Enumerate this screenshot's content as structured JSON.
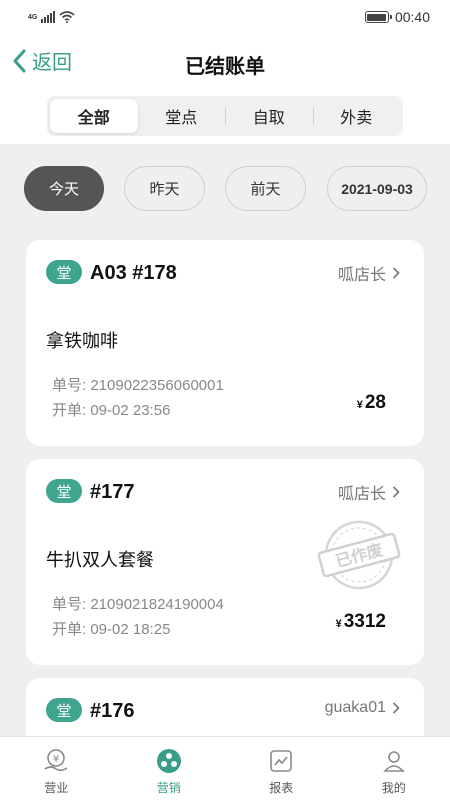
{
  "status_bar": {
    "network": "4G",
    "time": "00:40"
  },
  "header": {
    "back_label": "返回",
    "title": "已结账单"
  },
  "tabs": [
    {
      "label": "全部",
      "active": true
    },
    {
      "label": "堂点",
      "active": false
    },
    {
      "label": "自取",
      "active": false
    },
    {
      "label": "外卖",
      "active": false
    }
  ],
  "date_filters": [
    {
      "label": "今天",
      "active": true
    },
    {
      "label": "昨天",
      "active": false
    },
    {
      "label": "前天",
      "active": false
    },
    {
      "label": "2021-09-03",
      "active": false
    }
  ],
  "orders": [
    {
      "type_badge": "堂",
      "code": "A03 #178",
      "operator": "呱店长",
      "item": "拿铁咖啡",
      "order_no_label": "单号:",
      "order_no": "2109022356060001",
      "open_label": "开单:",
      "open_time": "09-02 23:56",
      "currency": "¥",
      "amount": "28",
      "voided": false
    },
    {
      "type_badge": "堂",
      "code": "#177",
      "operator": "呱店长",
      "item": "牛扒双人套餐",
      "order_no_label": "单号:",
      "order_no": "2109021824190004",
      "open_label": "开单:",
      "open_time": "09-02 18:25",
      "currency": "¥",
      "amount": "3312",
      "voided": true,
      "void_stamp": "已作废"
    },
    {
      "type_badge": "堂",
      "code": "#176",
      "operator": "guaka01"
    }
  ],
  "bottom_nav": [
    {
      "label": "营业",
      "icon": "business-icon",
      "active": false
    },
    {
      "label": "营销",
      "icon": "marketing-icon",
      "active": true
    },
    {
      "label": "报表",
      "icon": "report-icon",
      "active": false
    },
    {
      "label": "我的",
      "icon": "profile-icon",
      "active": false
    }
  ],
  "colors": {
    "accent": "#3a9d8a",
    "badge": "#3fa58f",
    "active_chip": "#555555",
    "background": "#efefef"
  }
}
